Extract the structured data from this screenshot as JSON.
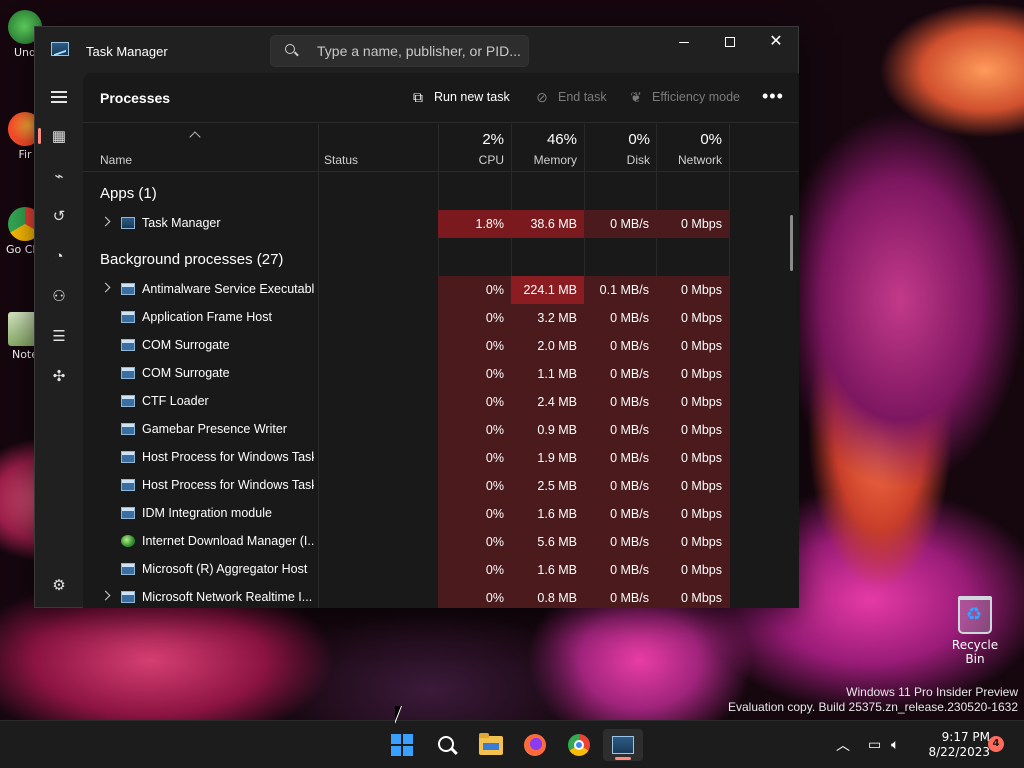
{
  "desktop": {
    "icons": [
      {
        "label": "Und"
      },
      {
        "label": "Fir"
      },
      {
        "label": "Go Chr"
      },
      {
        "label": "Note"
      }
    ],
    "recycle_bin_label": "Recycle Bin",
    "watermark": {
      "line1": "Windows 11 Pro Insider Preview",
      "line2": "Evaluation copy. Build 25375.zn_release.230520-1632"
    }
  },
  "window": {
    "title": "Task Manager",
    "search_placeholder": "Type a name, publisher, or PID..."
  },
  "commandbar": {
    "page_title": "Processes",
    "run_new_task": "Run new task",
    "end_task": "End task",
    "efficiency_mode": "Efficiency mode",
    "more": "•••"
  },
  "table": {
    "headers": {
      "name": "Name",
      "status": "Status",
      "cpu_pct": "2%",
      "cpu": "CPU",
      "mem_pct": "46%",
      "mem": "Memory",
      "disk_pct": "0%",
      "disk": "Disk",
      "net_pct": "0%",
      "net": "Network"
    },
    "groups": {
      "apps": "Apps (1)",
      "background": "Background processes (27)"
    },
    "apps": [
      {
        "name": "Task Manager",
        "cpu": "1.8%",
        "mem": "38.6 MB",
        "disk": "0 MB/s",
        "net": "0 Mbps"
      }
    ],
    "background": [
      {
        "name": "Antimalware Service Executable",
        "cpu": "0%",
        "mem": "224.1 MB",
        "disk": "0.1 MB/s",
        "net": "0 Mbps"
      },
      {
        "name": "Application Frame Host",
        "cpu": "0%",
        "mem": "3.2 MB",
        "disk": "0 MB/s",
        "net": "0 Mbps"
      },
      {
        "name": "COM Surrogate",
        "cpu": "0%",
        "mem": "2.0 MB",
        "disk": "0 MB/s",
        "net": "0 Mbps"
      },
      {
        "name": "COM Surrogate",
        "cpu": "0%",
        "mem": "1.1 MB",
        "disk": "0 MB/s",
        "net": "0 Mbps"
      },
      {
        "name": "CTF Loader",
        "cpu": "0%",
        "mem": "2.4 MB",
        "disk": "0 MB/s",
        "net": "0 Mbps"
      },
      {
        "name": "Gamebar Presence Writer",
        "cpu": "0%",
        "mem": "0.9 MB",
        "disk": "0 MB/s",
        "net": "0 Mbps"
      },
      {
        "name": "Host Process for Windows Tasks",
        "cpu": "0%",
        "mem": "1.9 MB",
        "disk": "0 MB/s",
        "net": "0 Mbps"
      },
      {
        "name": "Host Process for Windows Tasks",
        "cpu": "0%",
        "mem": "2.5 MB",
        "disk": "0 MB/s",
        "net": "0 Mbps"
      },
      {
        "name": "IDM Integration module",
        "cpu": "0%",
        "mem": "1.6 MB",
        "disk": "0 MB/s",
        "net": "0 Mbps"
      },
      {
        "name": "Internet Download Manager (I...",
        "cpu": "0%",
        "mem": "5.6 MB",
        "disk": "0 MB/s",
        "net": "0 Mbps"
      },
      {
        "name": "Microsoft (R) Aggregator Host",
        "cpu": "0%",
        "mem": "1.6 MB",
        "disk": "0 MB/s",
        "net": "0 Mbps"
      },
      {
        "name": "Microsoft Network Realtime I...",
        "cpu": "0%",
        "mem": "0.8 MB",
        "disk": "0 MB/s",
        "net": "0 Mbps"
      }
    ]
  },
  "taskbar": {
    "time": "9:17 PM",
    "date": "8/22/2023",
    "notification_count": "4"
  },
  "colors": {
    "heat_high": "#7a1a1e",
    "heat_low": "#4a1a1c",
    "heat_mem_high": "#8a1c22",
    "accent": "#ff8a80"
  }
}
